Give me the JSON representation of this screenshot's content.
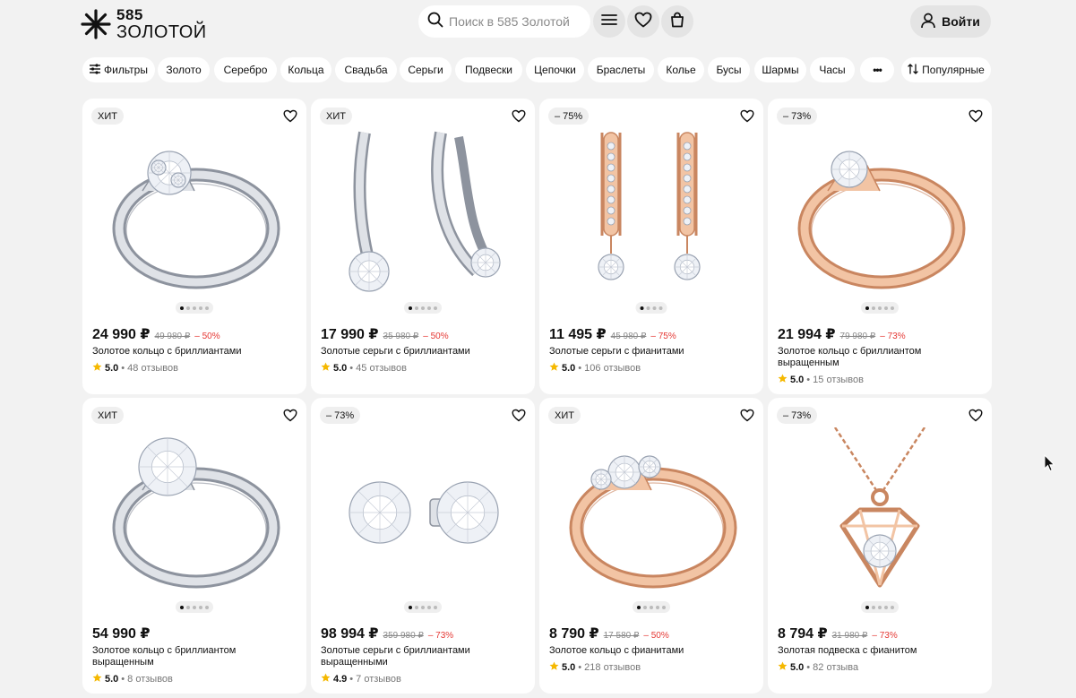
{
  "header": {
    "logo_number": "585",
    "logo_word": "ЗОЛОТОЙ",
    "search_placeholder": "Поиск в 585 Золотой",
    "login_label": "Войти"
  },
  "filters": {
    "filter_label": "Фильтры",
    "chips": [
      "Золото",
      "Серебро",
      "Кольца",
      "Свадьба",
      "Серьги",
      "Подвески",
      "Цепочки",
      "Браслеты",
      "Колье",
      "Бусы",
      "Шармы",
      "Часы"
    ],
    "more_label": "•••",
    "sort_label": "Популярные"
  },
  "icons": {
    "logo": "star-burst-icon",
    "search": "search-icon",
    "menu": "menu-icon",
    "favorites": "heart-icon",
    "cart": "bag-icon",
    "user": "user-icon",
    "filters": "sliders-icon",
    "sort": "sort-icon",
    "rating": "star-icon"
  },
  "colors": {
    "discount": "#e53935",
    "star": "#f5b800",
    "background": "#f2f2f2"
  },
  "products": [
    {
      "badge": "ХИТ",
      "price": "24 990 ₽",
      "old_price": "49 980 ₽",
      "discount": "– 50%",
      "title": "Золотое кольцо с бриллиантами",
      "rating": "5.0",
      "reviews": "48 отзывов",
      "dots": 5,
      "active_dot": 1
    },
    {
      "badge": "ХИТ",
      "price": "17 990 ₽",
      "old_price": "35 980 ₽",
      "discount": "– 50%",
      "title": "Золотые серьги с бриллиантами",
      "rating": "5.0",
      "reviews": "45 отзывов",
      "dots": 5,
      "active_dot": 1
    },
    {
      "badge": "– 75%",
      "price": "11 495 ₽",
      "old_price": "45 980 ₽",
      "discount": "– 75%",
      "title": "Золотые серьги с фианитами",
      "rating": "5.0",
      "reviews": "106 отзывов",
      "dots": 4,
      "active_dot": 1
    },
    {
      "badge": "– 73%",
      "price": "21 994 ₽",
      "old_price": "79 980 ₽",
      "discount": "– 73%",
      "title": "Золотое кольцо с бриллиантом выращенным",
      "rating": "5.0",
      "reviews": "15 отзывов",
      "dots": 5,
      "active_dot": 1
    },
    {
      "badge": "ХИТ",
      "price": "54 990 ₽",
      "old_price": "",
      "discount": "",
      "title": "Золотое кольцо с бриллиантом выращенным",
      "rating": "5.0",
      "reviews": "8 отзывов",
      "dots": 5,
      "active_dot": 1
    },
    {
      "badge": "– 73%",
      "price": "98 994 ₽",
      "old_price": "359 980 ₽",
      "discount": "– 73%",
      "title": "Золотые серьги с бриллиантами выращенными",
      "rating": "4.9",
      "reviews": "7 отзывов",
      "dots": 5,
      "active_dot": 1
    },
    {
      "badge": "ХИТ",
      "price": "8 790 ₽",
      "old_price": "17 580 ₽",
      "discount": "– 50%",
      "title": "Золотое кольцо с фианитами",
      "rating": "5.0",
      "reviews": "218 отзывов",
      "dots": 5,
      "active_dot": 1
    },
    {
      "badge": "– 73%",
      "price": "8 794 ₽",
      "old_price": "31 980 ₽",
      "discount": "– 73%",
      "title": "Золотая подвеска с фианитом",
      "rating": "5.0",
      "reviews": "82 отзыва",
      "dots": 5,
      "active_dot": 1
    }
  ]
}
